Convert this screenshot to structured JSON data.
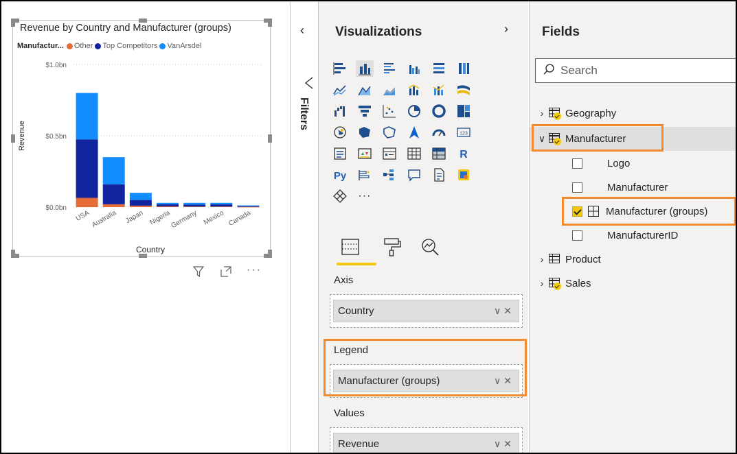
{
  "chart": {
    "title": "Revenue by Country and Manufacturer (groups)",
    "legend_title": "Manufactur...",
    "legend": [
      {
        "label": "Other",
        "color": "#E66C37"
      },
      {
        "label": "Top Competitors",
        "color": "#12239E"
      },
      {
        "label": "VanArsdel",
        "color": "#118DFF"
      }
    ]
  },
  "chart_data": {
    "type": "bar",
    "stacked": true,
    "title": "Revenue by Country and Manufacturer (groups)",
    "xlabel": "Country",
    "ylabel": "Revenue",
    "categories": [
      "USA",
      "Australia",
      "Japan",
      "Nigeria",
      "Germany",
      "Mexico",
      "Canada"
    ],
    "series": [
      {
        "name": "Other",
        "color": "#E66C37",
        "values": [
          0.065,
          0.02,
          0.01,
          0.005,
          0.004,
          0.004,
          0.002
        ]
      },
      {
        "name": "Top Competitors",
        "color": "#12239E",
        "values": [
          0.41,
          0.14,
          0.04,
          0.015,
          0.014,
          0.015,
          0.006
        ]
      },
      {
        "name": "VanArsdel",
        "color": "#118DFF",
        "values": [
          0.325,
          0.19,
          0.05,
          0.01,
          0.012,
          0.011,
          0.004
        ]
      }
    ],
    "yticks": [
      "$0.0bn",
      "$0.5bn",
      "$1.0bn"
    ],
    "ylim": [
      0,
      1.0
    ],
    "grid": true,
    "legend_position": "top-left"
  },
  "filters": {
    "label": "Filters",
    "collapse_glyph": "‹"
  },
  "visualizations": {
    "title": "Visualizations",
    "chevron": "›",
    "more": "···",
    "wells": [
      {
        "label": "Axis",
        "field": "Country"
      },
      {
        "label": "Legend",
        "field": "Manufacturer (groups)"
      },
      {
        "label": "Values",
        "field": "Revenue"
      }
    ],
    "r_label": "R",
    "py_label": "Py",
    "kpi_label": "123"
  },
  "fields": {
    "title": "Fields",
    "search_placeholder": "Search",
    "tables": [
      {
        "name": "Geography"
      },
      {
        "name": "Manufacturer"
      },
      {
        "name": "Product"
      },
      {
        "name": "Sales"
      }
    ],
    "manufacturer_fields": [
      {
        "name": "Logo"
      },
      {
        "name": "Manufacturer"
      },
      {
        "name": "Manufacturer (groups)"
      },
      {
        "name": "ManufacturerID"
      }
    ]
  },
  "colors": {
    "accent": "#F2C811",
    "highlight": "#F28A2E"
  }
}
